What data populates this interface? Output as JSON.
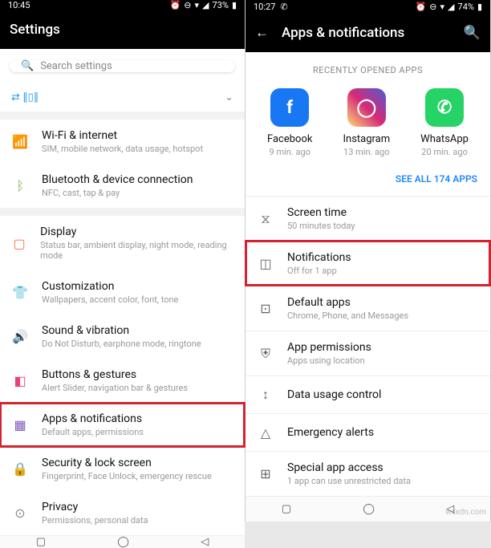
{
  "left": {
    "status": {
      "time": "10:45",
      "battery": "73%"
    },
    "header": "Settings",
    "search_placeholder": "Search settings",
    "items": [
      {
        "icon": "📶",
        "title": "Wi-Fi & internet",
        "sub": "SIM, mobile network, data usage, hotspot",
        "color": "#1e88ff"
      },
      {
        "icon": "ᛒ",
        "title": "Bluetooth & device connection",
        "sub": "NFC, cast, tap & pay",
        "color": "#7cb342"
      },
      {
        "icon": "▢",
        "title": "Display",
        "sub": "Status bar, ambient display, night mode, reading mode",
        "color": "#ff7043"
      },
      {
        "icon": "👕",
        "title": "Customization",
        "sub": "Wallpapers, accent color, font, tone",
        "color": "#ef5350"
      },
      {
        "icon": "🔊",
        "title": "Sound & vibration",
        "sub": "Do Not Disturb, earphone mode, ringtone",
        "color": "#888"
      },
      {
        "icon": "◧",
        "title": "Buttons & gestures",
        "sub": "Alert Slider, navigation bar & gestures",
        "color": "#ec407a"
      },
      {
        "icon": "▦",
        "title": "Apps & notifications",
        "sub": "Default apps, permissions",
        "color": "#7e57c2",
        "hl": true
      },
      {
        "icon": "🔒",
        "title": "Security & lock screen",
        "sub": "Fingerprint, Face Unlock, emergency rescue",
        "color": "#ec407a"
      },
      {
        "icon": "⊙",
        "title": "Privacy",
        "sub": "Permissions, personal data",
        "color": "#888"
      }
    ]
  },
  "right": {
    "status": {
      "time": "10:27",
      "battery": "74%"
    },
    "header": "Apps & notifications",
    "recent_label": "RECENTLY OPENED APPS",
    "apps": [
      {
        "name": "Facebook",
        "sub": "9 min. ago",
        "bg": "#1877f2",
        "g": "f"
      },
      {
        "name": "Instagram",
        "sub": "13 min. ago",
        "bg": "linear-gradient(45deg,#feda75,#d62976,#4f5bd5)",
        "g": "◯"
      },
      {
        "name": "WhatsApp",
        "sub": "20 min. ago",
        "bg": "#25d366",
        "g": "✆"
      }
    ],
    "see_all": "SEE ALL 174 APPS",
    "items": [
      {
        "icon": "⧖",
        "title": "Screen time",
        "sub": "50 minutes today"
      },
      {
        "icon": "◫",
        "title": "Notifications",
        "sub": "Off for 1 app",
        "hl": true
      },
      {
        "icon": "⊡",
        "title": "Default apps",
        "sub": "Chrome, Phone, and Messages"
      },
      {
        "icon": "⛨",
        "title": "App permissions",
        "sub": "Apps using location"
      },
      {
        "icon": "↕",
        "title": "Data usage control",
        "sub": ""
      },
      {
        "icon": "△",
        "title": "Emergency alerts",
        "sub": ""
      },
      {
        "icon": "⊞",
        "title": "Special app access",
        "sub": "1 app can use unrestricted data"
      }
    ]
  },
  "watermark": "wsxdn.com"
}
